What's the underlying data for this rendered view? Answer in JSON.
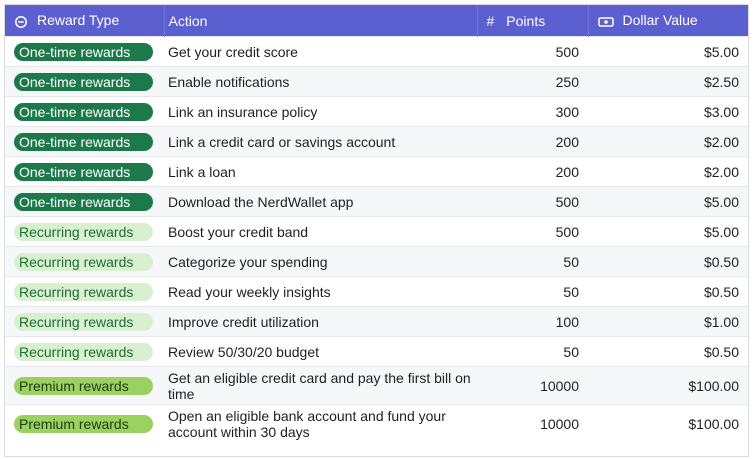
{
  "headers": {
    "reward_type": "Reward Type",
    "action": "Action",
    "points": "Points",
    "dollar_value": "Dollar Value",
    "points_icon_glyph": "#"
  },
  "colors": {
    "header_bg": "#5b5fcf",
    "onetime_badge": "#1c7a4a",
    "recurring_badge": "#d8f0cf",
    "premium_badge": "#9ad160"
  },
  "rows": [
    {
      "type": "One-time rewards",
      "kind": "onetime",
      "action": "Get your credit score",
      "points": "500",
      "value": "$5.00"
    },
    {
      "type": "One-time rewards",
      "kind": "onetime",
      "action": "Enable notifications",
      "points": "250",
      "value": "$2.50"
    },
    {
      "type": "One-time rewards",
      "kind": "onetime",
      "action": "Link an insurance policy",
      "points": "300",
      "value": "$3.00"
    },
    {
      "type": "One-time rewards",
      "kind": "onetime",
      "action": "Link a credit card or savings account",
      "points": "200",
      "value": "$2.00"
    },
    {
      "type": "One-time rewards",
      "kind": "onetime",
      "action": "Link a loan",
      "points": "200",
      "value": "$2.00"
    },
    {
      "type": "One-time rewards",
      "kind": "onetime",
      "action": "Download the NerdWallet app",
      "points": "500",
      "value": "$5.00"
    },
    {
      "type": "Recurring rewards",
      "kind": "recurring",
      "action": "Boost your credit band",
      "points": "500",
      "value": "$5.00"
    },
    {
      "type": "Recurring rewards",
      "kind": "recurring",
      "action": "Categorize your spending",
      "points": "50",
      "value": "$0.50"
    },
    {
      "type": "Recurring rewards",
      "kind": "recurring",
      "action": "Read your weekly insights",
      "points": "50",
      "value": "$0.50"
    },
    {
      "type": "Recurring rewards",
      "kind": "recurring",
      "action": "Improve credit utilization",
      "points": "100",
      "value": "$1.00"
    },
    {
      "type": "Recurring rewards",
      "kind": "recurring",
      "action": "Review 50/30/20 budget",
      "points": "50",
      "value": "$0.50"
    },
    {
      "type": "Premium rewards",
      "kind": "premium",
      "action": "Get an eligible credit card and pay the first bill on time",
      "points": "10000",
      "value": "$100.00"
    },
    {
      "type": "Premium rewards",
      "kind": "premium",
      "action": "Open an eligible bank account and fund your account within 30 days",
      "points": "10000",
      "value": "$100.00"
    }
  ]
}
